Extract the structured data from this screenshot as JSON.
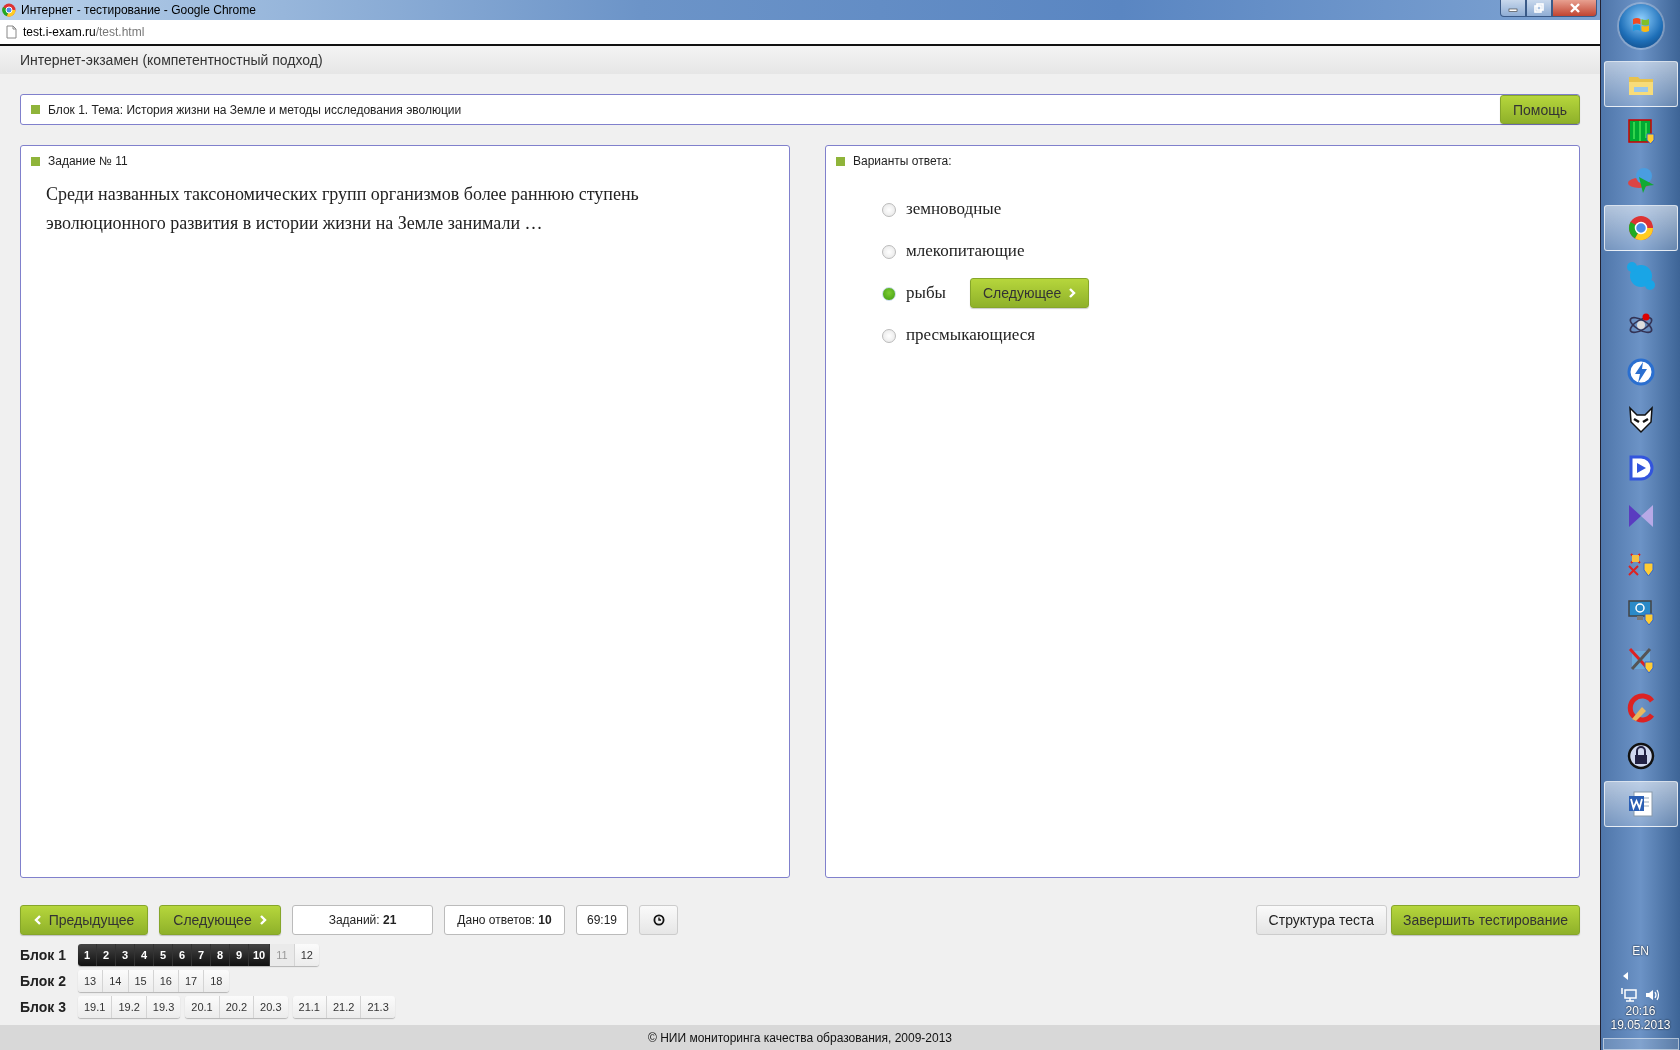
{
  "window": {
    "title": "Интернет - тестирование - Google Chrome"
  },
  "address_bar": {
    "host": "test.i-exam.ru",
    "path": "/test.html"
  },
  "header": {
    "title": "Интернет-экзамен (компетентностный подход)"
  },
  "topic_bar": {
    "text": "Блок 1. Тема: История жизни на Земле и методы исследования эволюции",
    "help_button": "Помощь"
  },
  "task_panel": {
    "heading": "Задание № 11",
    "question": "Среди названных таксономических групп организмов более раннюю ступень эволюционного развития в истории жизни на Земле занимали …"
  },
  "answer_panel": {
    "heading": "Варианты ответа:",
    "next_button": "Следующее",
    "options": [
      {
        "label": "земноводные",
        "selected": false
      },
      {
        "label": "млекопитающие",
        "selected": false
      },
      {
        "label": "рыбы",
        "selected": true
      },
      {
        "label": "пресмыкающиеся",
        "selected": false
      }
    ]
  },
  "toolbar": {
    "prev_button": "Предыдущее",
    "next_button": "Следующее",
    "tasks": "Заданий: **21**",
    "answers": "Дано ответов: **10**",
    "timer": "69:19",
    "structure_button": "Структура теста",
    "finish_button": "Завершить тестирование"
  },
  "blocks": [
    {
      "label": "Блок 1",
      "groups": [
        {
          "items": [
            {
              "label": "1",
              "answered": true,
              "selected": false
            },
            {
              "label": "2",
              "answered": true,
              "selected": false
            },
            {
              "label": "3",
              "answered": true,
              "selected": false
            },
            {
              "label": "4",
              "answered": true,
              "selected": false
            },
            {
              "label": "5",
              "answered": true,
              "selected": false
            },
            {
              "label": "6",
              "answered": true,
              "selected": false
            },
            {
              "label": "7",
              "answered": true,
              "selected": false
            },
            {
              "label": "8",
              "answered": true,
              "selected": false
            },
            {
              "label": "9",
              "answered": true,
              "selected": false
            },
            {
              "label": "10",
              "answered": true,
              "selected": false
            },
            {
              "label": "11",
              "answered": false,
              "selected": true
            },
            {
              "label": "12",
              "answered": false,
              "selected": false
            }
          ]
        }
      ]
    },
    {
      "label": "Блок 2",
      "groups": [
        {
          "items": [
            {
              "label": "13",
              "answered": false,
              "selected": false
            },
            {
              "label": "14",
              "answered": false,
              "selected": false
            },
            {
              "label": "15",
              "answered": false,
              "selected": false
            },
            {
              "label": "16",
              "answered": false,
              "selected": false
            },
            {
              "label": "17",
              "answered": false,
              "selected": false
            },
            {
              "label": "18",
              "answered": false,
              "selected": false
            }
          ]
        }
      ]
    },
    {
      "label": "Блок 3",
      "groups": [
        {
          "items": [
            {
              "label": "19.1",
              "answered": false,
              "selected": false
            },
            {
              "label": "19.2",
              "answered": false,
              "selected": false
            },
            {
              "label": "19.3",
              "answered": false,
              "selected": false
            }
          ]
        },
        {
          "items": [
            {
              "label": "20.1",
              "answered": false,
              "selected": false
            },
            {
              "label": "20.2",
              "answered": false,
              "selected": false
            },
            {
              "label": "20.3",
              "answered": false,
              "selected": false
            }
          ]
        },
        {
          "items": [
            {
              "label": "21.1",
              "answered": false,
              "selected": false
            },
            {
              "label": "21.2",
              "answered": false,
              "selected": false
            },
            {
              "label": "21.3",
              "answered": false,
              "selected": false
            }
          ]
        }
      ]
    }
  ],
  "footer": "© НИИ мониторинга качества образования, 2009-2013",
  "taskbar": {
    "items": [
      {
        "kind": "folder",
        "active": true
      },
      {
        "kind": "screen",
        "active": false
      },
      {
        "kind": "globe",
        "active": false
      },
      {
        "kind": "browser",
        "active": true
      },
      {
        "kind": "bubble",
        "active": false
      },
      {
        "kind": "atom",
        "active": false
      },
      {
        "kind": "bolt",
        "active": false
      },
      {
        "kind": "mask",
        "active": false
      },
      {
        "kind": "play",
        "active": false
      },
      {
        "kind": "bowtie",
        "active": false
      },
      {
        "kind": "cross",
        "active": false
      },
      {
        "kind": "monitor",
        "active": false
      },
      {
        "kind": "tools",
        "active": false
      },
      {
        "kind": "broom",
        "active": false
      },
      {
        "kind": "lock",
        "active": false
      },
      {
        "kind": "document",
        "active": true
      }
    ],
    "language": "EN",
    "time": "20:16",
    "date": "19.05.2013"
  }
}
